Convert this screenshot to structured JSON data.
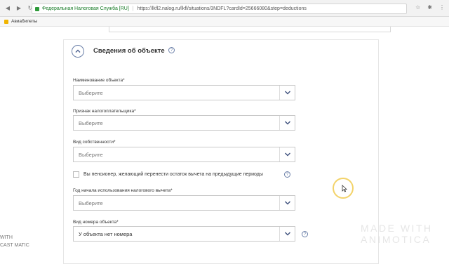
{
  "browser": {
    "site_name": "Федеральная Налоговая Служба [RU]",
    "url": "https://lkfl2.nalog.ru/lkfl/situations/3NDFL?cardId=25666080&step=deductions",
    "bookmark": "Авиабилеты"
  },
  "section": {
    "title": "Сведения об объекте",
    "help": "?"
  },
  "fields": {
    "object_name": {
      "label": "Наименование объекта*",
      "value": "Выберите"
    },
    "taxpayer_sign": {
      "label": "Признак налогоплательщика*",
      "value": "Выберите"
    },
    "ownership_type": {
      "label": "Вид собственности*",
      "value": "Выберите"
    },
    "pensioner_check": {
      "label": "Вы пенсионер, желающий перенести остаток вычета на предыдущие периоды"
    },
    "start_year": {
      "label": "Год начала использования налогового вычета*",
      "value": "Выберите"
    },
    "number_type": {
      "label": "Вид номера объекта*",
      "value": "У объекта нет номера"
    }
  },
  "watermark": {
    "line1": "MADE WITH",
    "line2": "ANIMOTICA",
    "left_text": "WITH",
    "left_brand": "CAST MATIC"
  },
  "icons": {
    "collapse": "chevron-up-icon",
    "dropdown": "chevron-down-icon",
    "help": "question-icon"
  }
}
